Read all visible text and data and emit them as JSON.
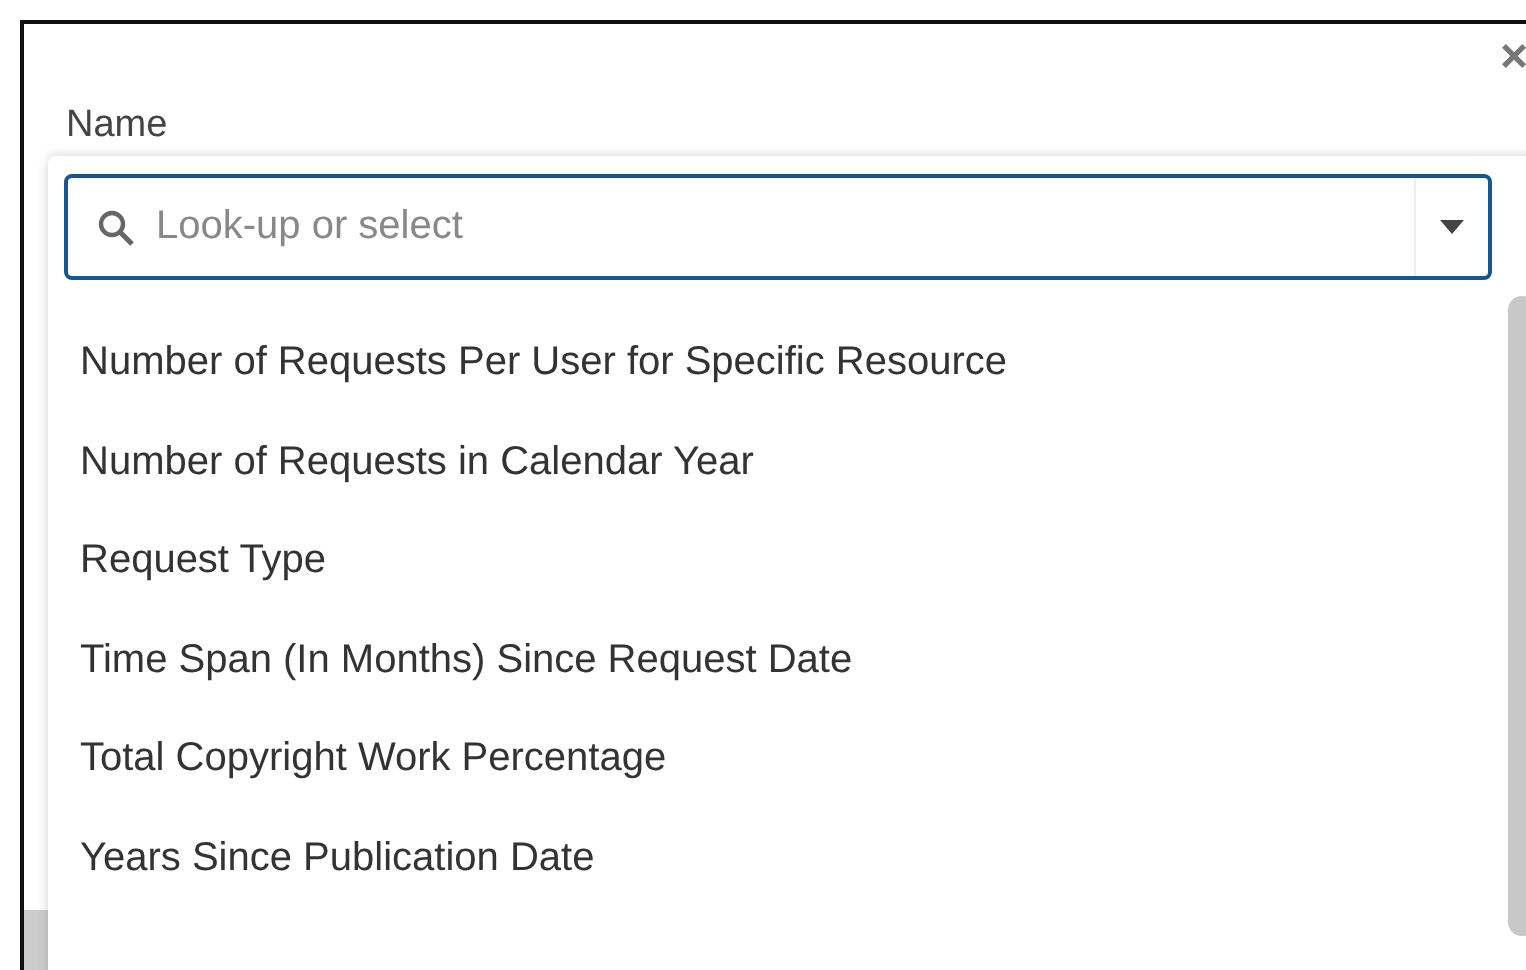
{
  "dialog": {
    "close": "×",
    "field_label": "Name"
  },
  "dropdown": {
    "placeholder": "Look-up or select",
    "expanded": true,
    "options": [
      {
        "label": "Number of Requests Per User for Specific Resource",
        "selected": false
      },
      {
        "label": "Number of Requests in Calendar Year",
        "selected": false
      },
      {
        "label": "Request Type",
        "selected": false
      },
      {
        "label": "Time Span (In Months) Since Request Date",
        "selected": false
      },
      {
        "label": "Total Copyright Work Percentage",
        "selected": false
      },
      {
        "label": "Years Since Publication Date",
        "selected": false
      }
    ]
  }
}
